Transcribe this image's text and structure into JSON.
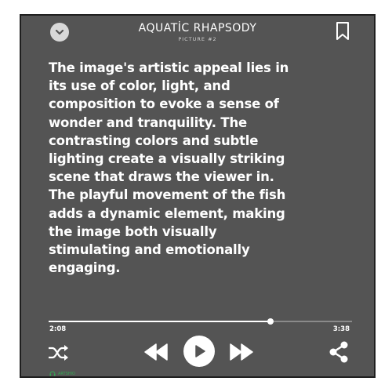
{
  "player": {
    "title": "AQUATİC RHAPSODY",
    "subtitle": "PICTURE #2",
    "text": "The image's artistic appeal lies in its use of color, light, and composition to evoke a sense of wonder and tranquility. The contrasting colors and subtle lighting create a visually striking scene that draws the viewer in. The playful movement of the fish adds a dynamic element, making the image both visually stimulating and emotionally engaging.",
    "elapsed": "2:08",
    "total": "3:38",
    "progress_fraction": 0.73,
    "credit": "ARTSHIO"
  },
  "icons": {
    "back": "chevron-down-icon",
    "bookmark": "bookmark-icon",
    "shuffle": "shuffle-icon",
    "previous": "skip-back-icon",
    "play": "play-icon",
    "next": "skip-forward-icon",
    "share": "share-icon",
    "credit": "headphones-icon"
  },
  "colors": {
    "card_background": "#545454",
    "text": "#ffffff",
    "credit": "#35a853"
  }
}
